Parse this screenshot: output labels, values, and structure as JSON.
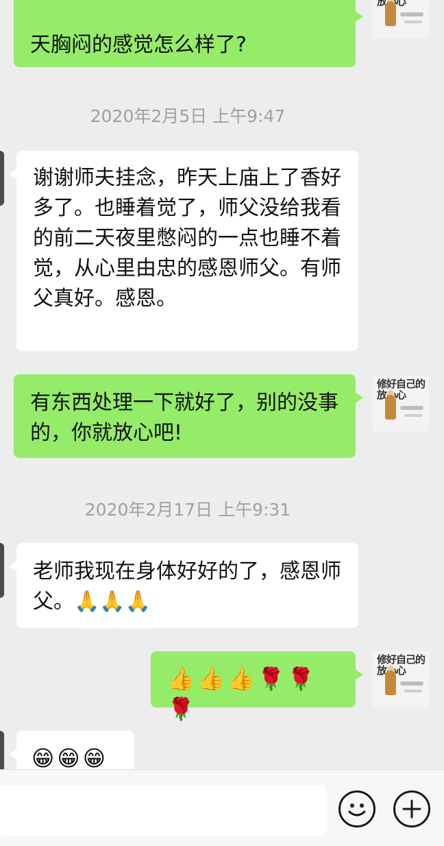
{
  "messages": [
    {
      "type": "outgoing",
      "text": "天胸闷的感觉怎么样了?"
    },
    {
      "type": "timestamp",
      "text": "2020年2月5日 上午9:47"
    },
    {
      "type": "incoming",
      "text": "谢谢师夫挂念，昨天上庙上了香好多了。也睡着觉了，师父没给我看的前二天夜里憋闷的一点也睡不着觉，从心里由忠的感恩师父。有师父真好。感恩。"
    },
    {
      "type": "outgoing",
      "text": "有东西处理一下就好了，别的没事的，你就放心吧!"
    },
    {
      "type": "timestamp",
      "text": "2020年2月17日 上午9:31"
    },
    {
      "type": "incoming",
      "text": "老师我现在身体好好的了，感恩师父。🙏🙏🙏"
    },
    {
      "type": "outgoing",
      "text": "👍👍👍🌹🌹🌹"
    },
    {
      "type": "incoming",
      "text": "😁😁😁"
    }
  ],
  "avatar_self": {
    "text": "修好自己的放心心"
  },
  "input_bar": {
    "placeholder": "",
    "emoji_icon": "smiley-face-icon",
    "plus_icon": "plus-circle-icon"
  },
  "colors": {
    "outgoing_bubble": "#95ec69",
    "incoming_bubble": "#ffffff",
    "background": "#ededed",
    "timestamp_text": "#a0a0a0"
  }
}
